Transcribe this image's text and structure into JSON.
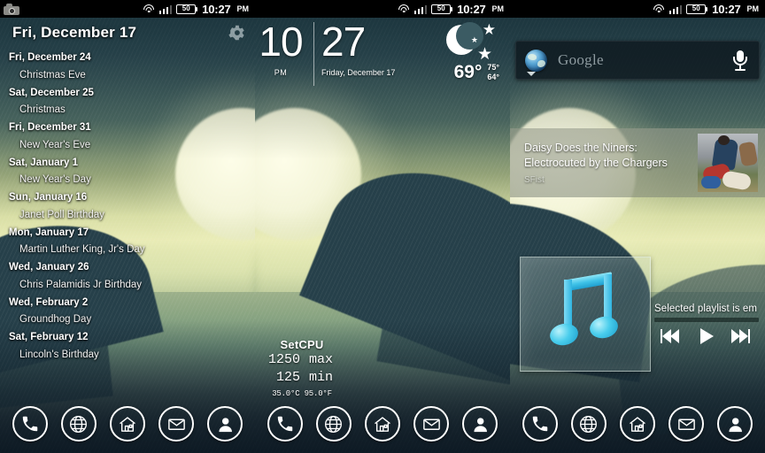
{
  "status_bar": {
    "left_icons": [
      "camera-icon"
    ],
    "wifi_icon": "wifi-icon",
    "signal_icon": "signal-bars-icon",
    "battery_level": "50",
    "time": "10:27",
    "ampm": "PM"
  },
  "panels": [
    {
      "id": "panel-calendar",
      "calendar_widget": {
        "title": "Fri, December 17",
        "settings_icon": "gear-icon",
        "entries": [
          {
            "date": "Fri, December 24",
            "event": "Christmas Eve"
          },
          {
            "date": "Sat, December 25",
            "event": "Christmas"
          },
          {
            "date": "Fri, December 31",
            "event": "New Year's Eve"
          },
          {
            "date": "Sat, January 1",
            "event": "New Year's Day"
          },
          {
            "date": "Sun, January 16",
            "event": "Janet Poll Birthday"
          },
          {
            "date": "Mon, January 17",
            "event": "Martin Luther King, Jr's Day"
          },
          {
            "date": "Wed, January 26",
            "event": "Chris Palamidis Jr Birthday"
          },
          {
            "date": "Wed, February 2",
            "event": "Groundhog Day"
          },
          {
            "date": "Sat, February 12",
            "event": "Lincoln's Birthday"
          }
        ]
      }
    },
    {
      "id": "panel-clock",
      "clock_widget": {
        "hour": "10",
        "minute": "27",
        "ampm": "PM",
        "date": "Friday, December 17"
      },
      "weather_widget": {
        "condition_icon": "moon-stars-icon",
        "current_temp": "69°",
        "high_temp": "75°",
        "low_temp": "64°"
      },
      "setcpu_widget": {
        "title": "SetCPU",
        "max_value": "1250",
        "max_label": "max",
        "min_value": "125",
        "min_label": "min",
        "temperature": "35.0°C  95.0°F"
      }
    },
    {
      "id": "panel-apps",
      "search_widget": {
        "brand_icon": "globe-icon",
        "dropdown_icon": "chevron-down-icon",
        "placeholder": "Google",
        "voice_icon": "microphone-icon"
      },
      "news_widget": {
        "headline": "Daisy Does the Niners: Electrocuted by the Chargers",
        "source": "SFist",
        "thumbnail": "football-photo"
      },
      "music_widget": {
        "album_art_icon": "music-note-icon",
        "status_text": "Selected playlist is em",
        "prev_icon": "skip-previous-icon",
        "play_icon": "play-icon",
        "next_icon": "skip-next-icon"
      }
    }
  ],
  "dock": {
    "items": [
      {
        "name": "phone",
        "icon": "phone-icon"
      },
      {
        "name": "browser",
        "icon": "globe-icon"
      },
      {
        "name": "home",
        "icon": "home-icon"
      },
      {
        "name": "email",
        "icon": "envelope-icon"
      },
      {
        "name": "contacts",
        "icon": "person-icon"
      }
    ]
  },
  "colors": {
    "accent": "#4fc8e8",
    "status_bar_bg": "#000000",
    "wallpaper_sky": "#2e4f58",
    "wallpaper_moon": "#f4f5d9"
  }
}
